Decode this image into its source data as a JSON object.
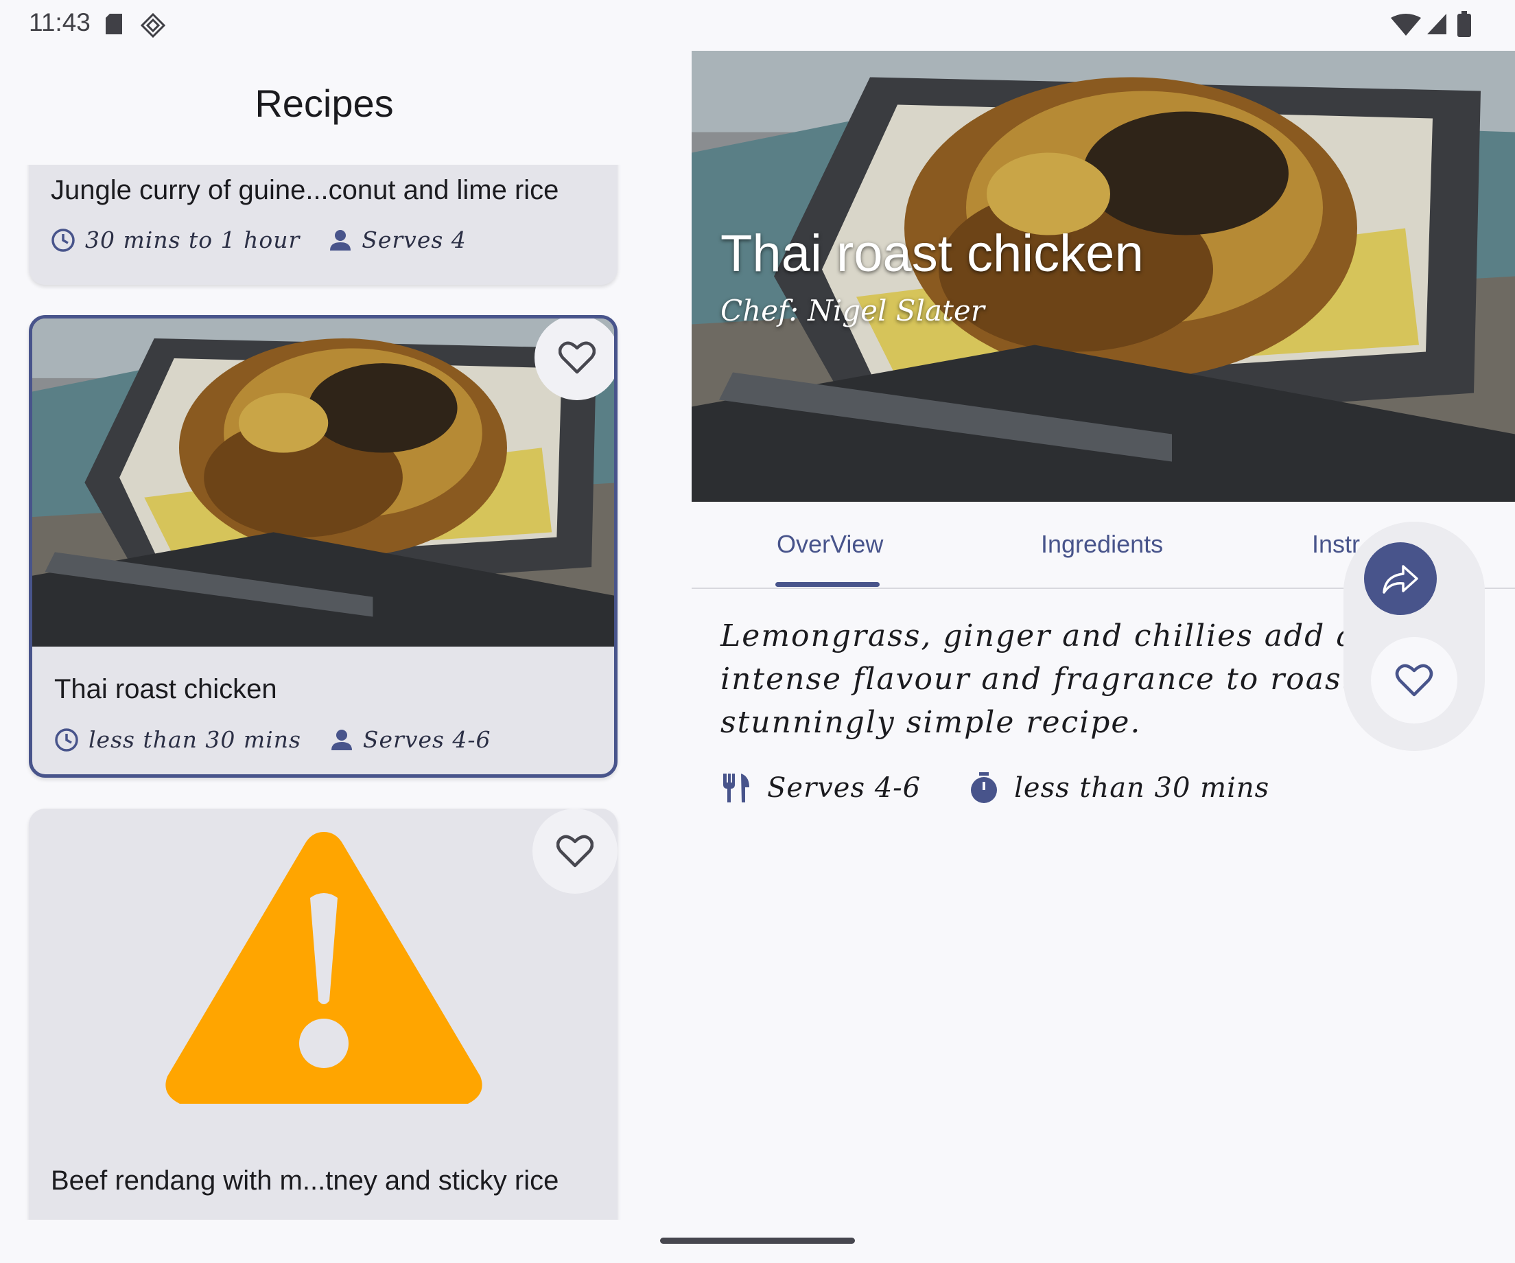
{
  "status_bar": {
    "time": "11:43"
  },
  "list": {
    "title": "Recipes",
    "cards": [
      {
        "title": "Jungle curry of guine...conut and lime rice",
        "time": "30 mins to 1 hour",
        "serves": "Serves 4"
      },
      {
        "title": "Thai roast chicken",
        "time": "less than 30 mins",
        "serves": "Serves 4-6",
        "selected": true
      },
      {
        "title": "Beef rendang with m...tney and sticky rice",
        "image_state": "warning-icon"
      }
    ]
  },
  "detail": {
    "title": "Thai roast chicken",
    "chef": "Chef: Nigel Slater",
    "tabs": [
      "OverView",
      "Ingredients",
      "Instr"
    ],
    "active_tab": "OverView",
    "description": "Lemongrass, ginger and chillies add a wonderfully intense flavour and fragrance to roast chicken in this stunningly simple recipe.",
    "serves": "Serves 4-6",
    "time": "less than 30 mins"
  },
  "colors": {
    "accent": "#48548b",
    "warning": "#ffa500",
    "card_bg": "#e4e4ea",
    "background": "#f8f8fb"
  }
}
